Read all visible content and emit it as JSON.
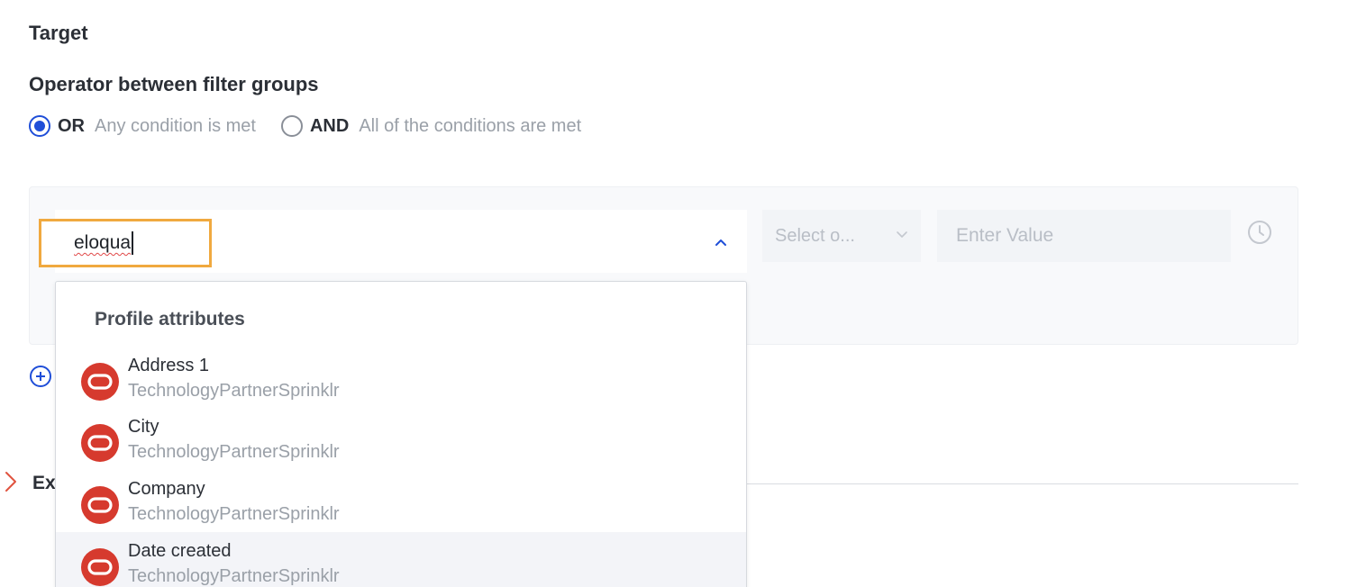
{
  "headings": {
    "target": "Target",
    "operator_between_groups": "Operator between filter groups"
  },
  "operator_options": [
    {
      "label": "OR",
      "description": "Any condition is met",
      "selected": true
    },
    {
      "label": "AND",
      "description": "All of the conditions are met",
      "selected": false
    }
  ],
  "filter": {
    "search_value": "eloqua",
    "operator_placeholder": "Select o...",
    "value_placeholder": "Enter Value"
  },
  "dropdown": {
    "section_title": "Profile attributes",
    "options": [
      {
        "label": "Address 1",
        "source": "TechnologyPartnerSprinklr",
        "icon": "oracle-logo-icon",
        "highlighted": false
      },
      {
        "label": "City",
        "source": "TechnologyPartnerSprinklr",
        "icon": "oracle-logo-icon",
        "highlighted": false
      },
      {
        "label": "Company",
        "source": "TechnologyPartnerSprinklr",
        "icon": "oracle-logo-icon",
        "highlighted": false
      },
      {
        "label": "Date created",
        "source": "TechnologyPartnerSprinklr",
        "icon": "oracle-logo-icon",
        "highlighted": true
      }
    ]
  },
  "section_collapsed": {
    "label_visible": "Ex"
  },
  "colors": {
    "accent": "#1f4ed8",
    "focus_border": "#f0a93f",
    "oracle_red": "#d63a2e",
    "expand_chevron": "#e0533f"
  }
}
